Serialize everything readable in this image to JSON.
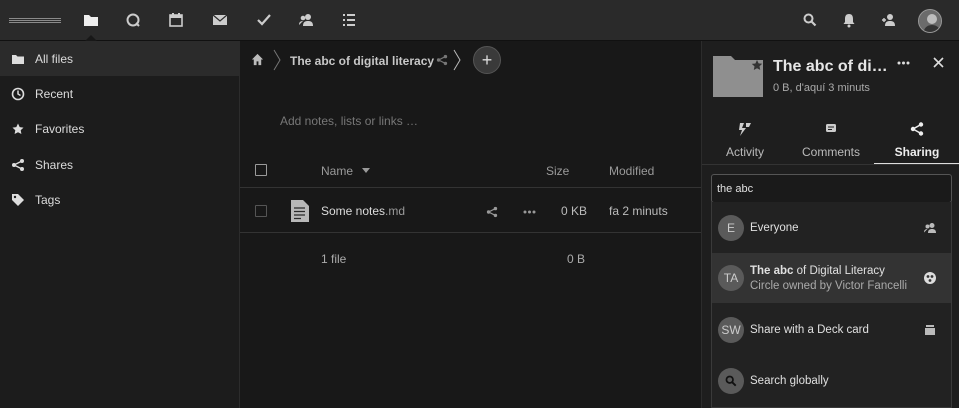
{
  "sidebar": {
    "items": [
      {
        "label": "All files",
        "icon": "folder-icon"
      },
      {
        "label": "Recent",
        "icon": "clock-icon"
      },
      {
        "label": "Favorites",
        "icon": "star-icon"
      },
      {
        "label": "Shares",
        "icon": "share-icon"
      },
      {
        "label": "Tags",
        "icon": "tag-icon"
      }
    ]
  },
  "breadcrumb": {
    "title": "The abc of digital literacy"
  },
  "main": {
    "notes_placeholder": "Add notes, lists or links …",
    "columns": {
      "name": "Name",
      "size": "Size",
      "modified": "Modified"
    },
    "files": [
      {
        "name": "Some notes",
        "ext": ".md",
        "size": "0 KB",
        "modified": "fa 2 minuts"
      }
    ],
    "summary": {
      "count": "1 file",
      "size": "0 B"
    }
  },
  "panel": {
    "title": "The abc of digital literacy",
    "subtitle": "0 B, d'aquí 3 minuts",
    "tabs": [
      {
        "label": "Activity",
        "icon": "activity-icon"
      },
      {
        "label": "Comments",
        "icon": "comment-icon"
      },
      {
        "label": "Sharing",
        "icon": "share-icon"
      }
    ],
    "share_input_value": "the abc",
    "results": [
      {
        "avatar": "E",
        "line1_bold": "",
        "line1": "Everyone",
        "line2": "",
        "icon": "group-icon"
      },
      {
        "avatar": "TA",
        "line1_bold": "The abc",
        "line1": " of Digital Literacy",
        "line2": "Circle owned by Victor Fancelli",
        "icon": "circles-icon"
      },
      {
        "avatar": "SW",
        "line1_bold": "",
        "line1": "Share with a Deck card",
        "line2": "",
        "icon": "deck-icon"
      },
      {
        "avatar": "",
        "line1_bold": "",
        "line1": "Search globally",
        "line2": "",
        "icon": "search-icon"
      }
    ]
  },
  "colors": {
    "topbar": "#2a2a2a",
    "background": "#181818",
    "sidebar": "#1c1c1c",
    "panel": "#1e1e1e"
  }
}
